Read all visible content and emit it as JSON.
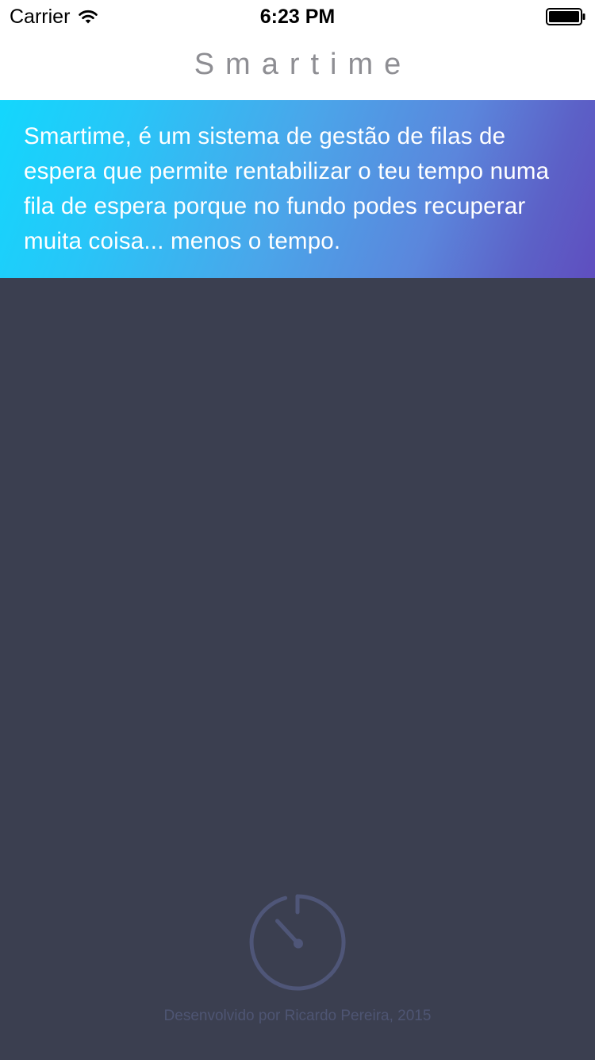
{
  "status_bar": {
    "carrier": "Carrier",
    "time": "6:23 PM",
    "icons": [
      "wifi-icon",
      "battery-icon"
    ]
  },
  "nav": {
    "title": "Smartime"
  },
  "hero": {
    "text": "Smartime, é um sistema de gestão de filas de espera que permite rentabilizar o teu tempo numa fila de espera porque no fundo podes recuperar muita coisa... menos o tempo.",
    "gradient_colors": [
      "#13d7fd",
      "#4aa6ea",
      "#5f4ebf"
    ]
  },
  "main": {
    "background_color": "#3b3f50",
    "timer_icon": "stopwatch-icon",
    "timer_color": "#4f5678",
    "footer_text": "Desenvolvido por Ricardo Pereira, 2015"
  }
}
